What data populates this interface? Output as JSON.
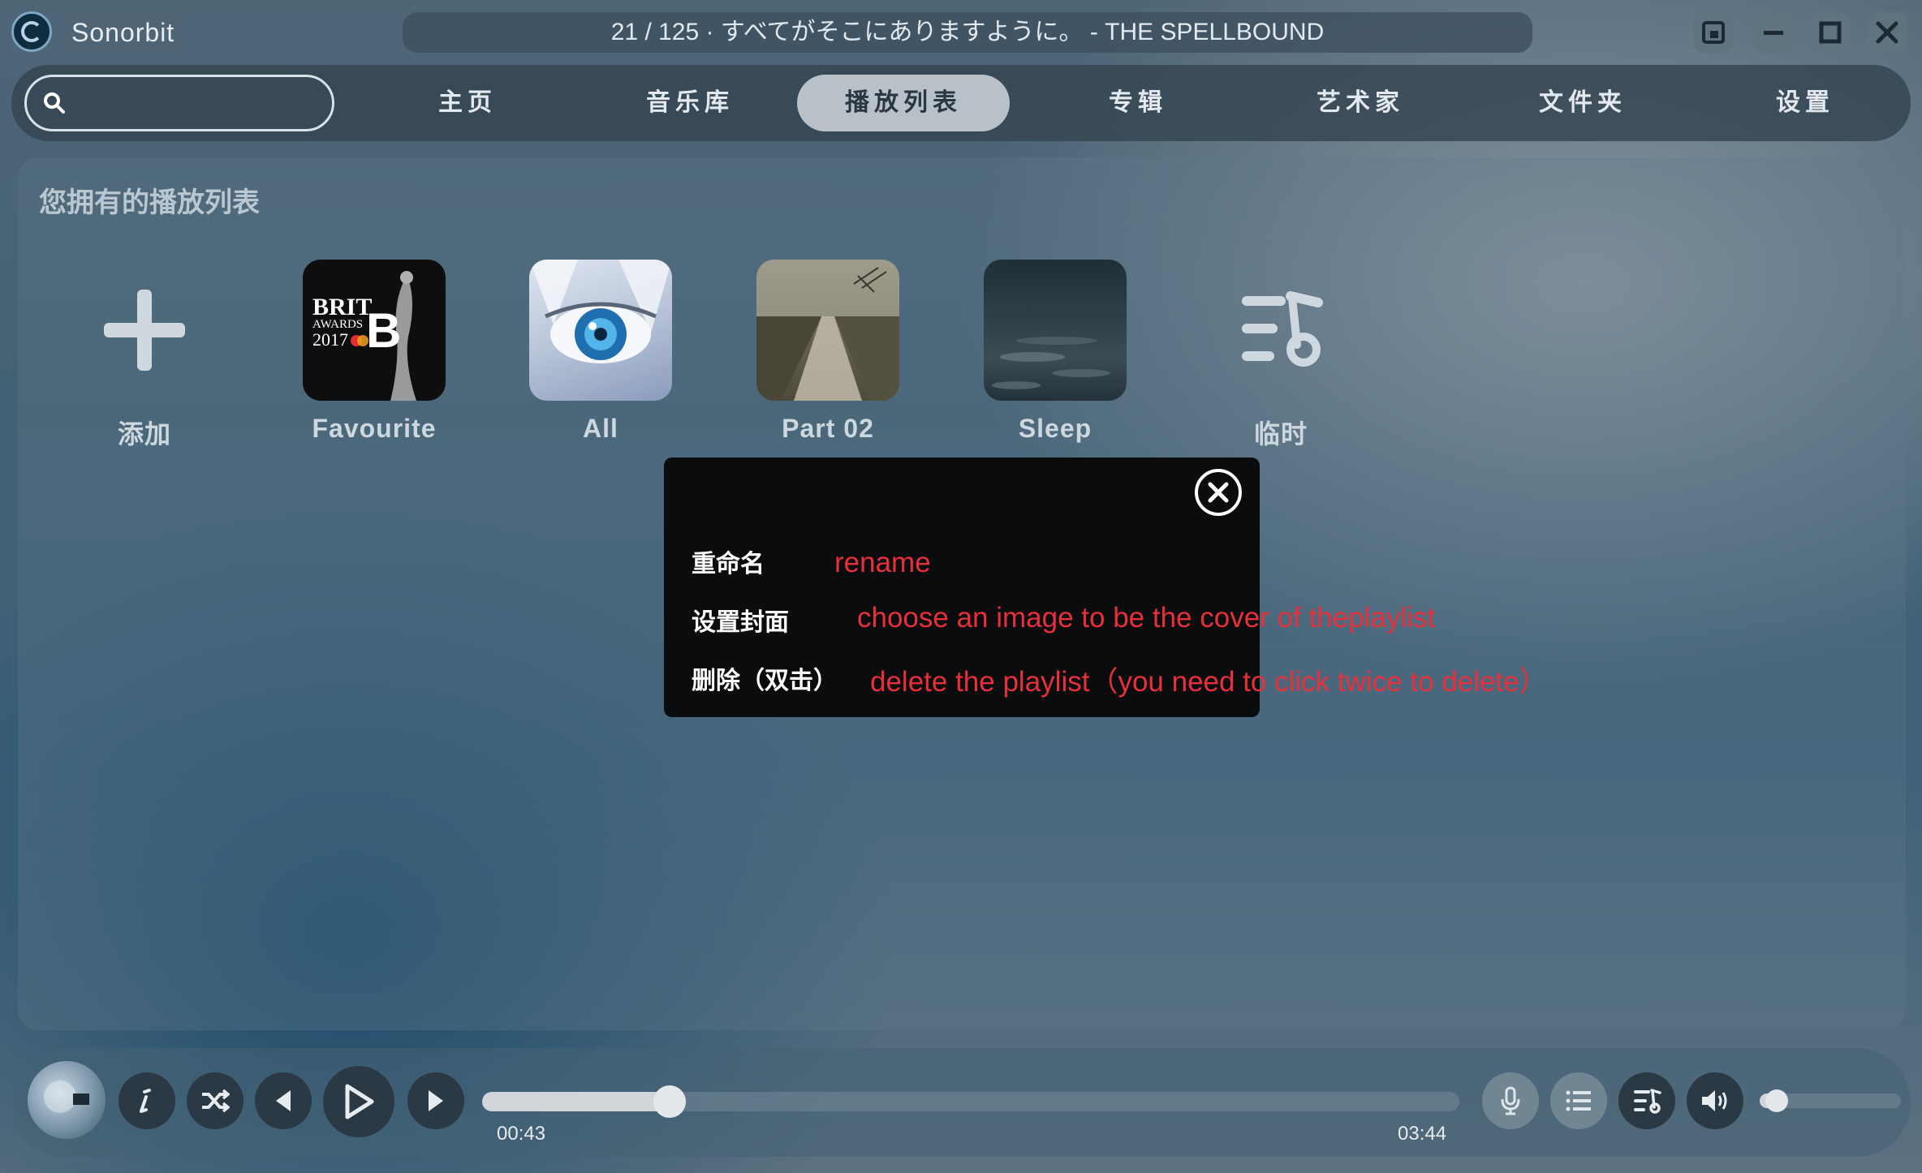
{
  "app": {
    "name": "Sonorbit"
  },
  "now_playing": {
    "text": "21 / 125 · すべてがそこにありますように。 - THE SPELLBOUND"
  },
  "window_controls": [
    "mini-mode-icon",
    "minimize-icon",
    "maximize-icon",
    "close-icon"
  ],
  "search": {
    "placeholder": "",
    "value": ""
  },
  "nav": {
    "tabs": [
      {
        "label": "主页",
        "active": false
      },
      {
        "label": "音乐库",
        "active": false
      },
      {
        "label": "播放列表",
        "active": true
      },
      {
        "label": "专辑",
        "active": false
      },
      {
        "label": "艺术家",
        "active": false
      },
      {
        "label": "文件夹",
        "active": false
      },
      {
        "label": "设置",
        "active": false
      }
    ]
  },
  "playlists": {
    "title": "您拥有的播放列表",
    "items": [
      {
        "label": "添加",
        "icon": "plus-icon"
      },
      {
        "label": "Favourite",
        "cover_text": [
          "BRIT",
          "AWARDS",
          "2017"
        ]
      },
      {
        "label": "All"
      },
      {
        "label": "Part 02"
      },
      {
        "label": "Sleep"
      },
      {
        "label": "临时",
        "icon": "queue-music-icon"
      }
    ]
  },
  "dialog": {
    "options": [
      {
        "label": "重命名",
        "annotation": "rename"
      },
      {
        "label": "设置封面",
        "annotation": "choose an image to be the cover of theplaylist"
      },
      {
        "label": "删除（双击）",
        "annotation": "delete the playlist（you need to click twice to delete）"
      }
    ],
    "annotation_color": "#e8303a"
  },
  "player": {
    "current_time": "00:43",
    "total_time": "03:44",
    "progress_percent": 19.2,
    "volume_percent": 12,
    "controls": [
      "lyrics-info-icon",
      "shuffle-icon",
      "previous-icon",
      "play-icon",
      "next-icon"
    ],
    "right_controls": [
      "microphone-icon",
      "list-icon",
      "playlist-icon",
      "volume-icon"
    ]
  },
  "colors": {
    "accent": "#b8c1c8",
    "dialog_bg": "#0b0c0e"
  }
}
